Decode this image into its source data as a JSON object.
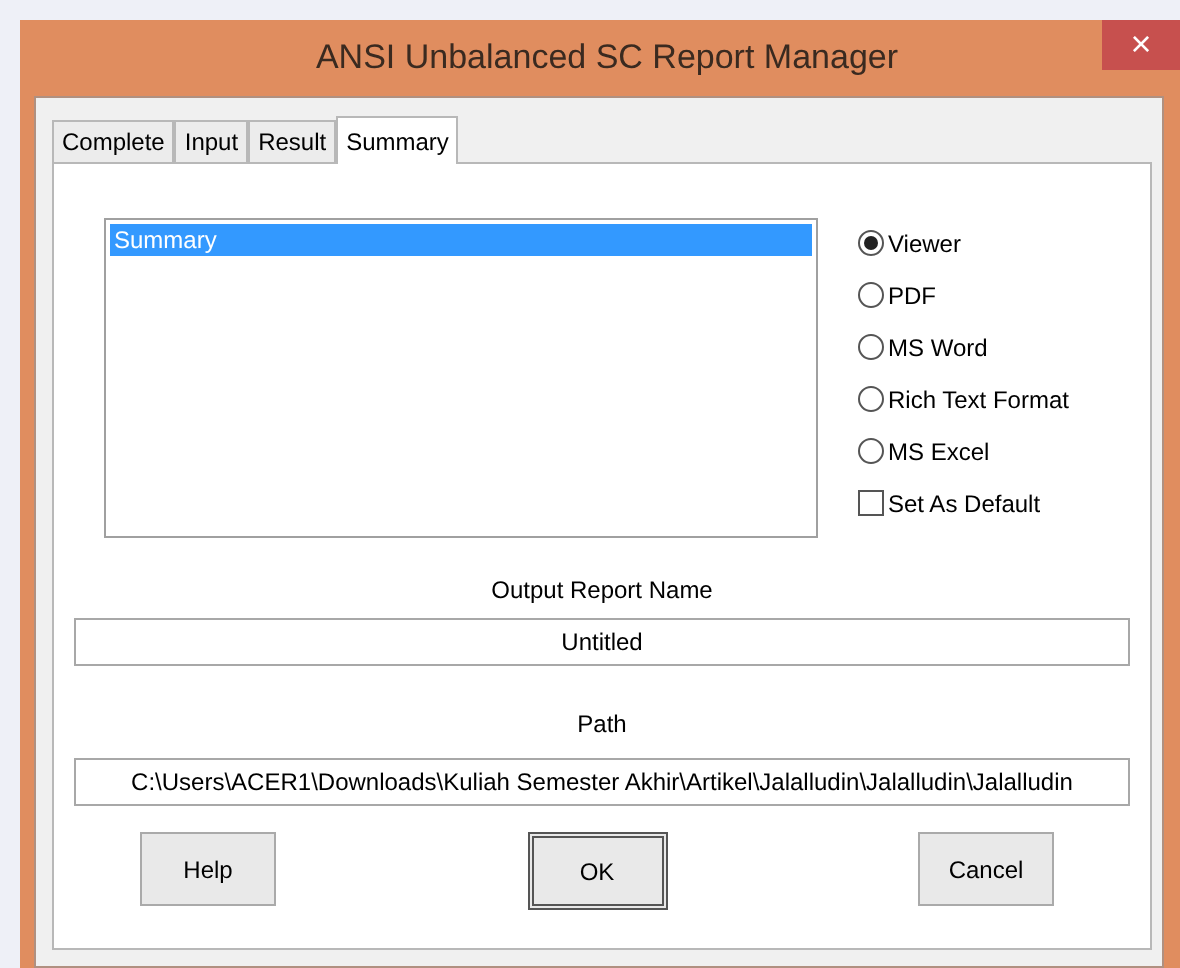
{
  "window": {
    "title": "ANSI Unbalanced SC Report Manager",
    "close": "×"
  },
  "tabs": [
    {
      "label": "Complete",
      "selected": false
    },
    {
      "label": "Input",
      "selected": false
    },
    {
      "label": "Result",
      "selected": false
    },
    {
      "label": "Summary",
      "selected": true
    }
  ],
  "report_list": [
    {
      "label": "Summary",
      "selected": true
    }
  ],
  "formats": [
    {
      "kind": "radio",
      "label": "Viewer",
      "selected": true
    },
    {
      "kind": "radio",
      "label": "PDF",
      "selected": false
    },
    {
      "kind": "radio",
      "label": "MS Word",
      "selected": false
    },
    {
      "kind": "radio",
      "label": "Rich Text Format",
      "selected": false
    },
    {
      "kind": "radio",
      "label": "MS Excel",
      "selected": false
    },
    {
      "kind": "checkbox",
      "label": "Set As Default",
      "checked": false
    }
  ],
  "output_name": {
    "label": "Output Report Name",
    "value": "Untitled"
  },
  "path": {
    "label": "Path",
    "value": "C:\\Users\\ACER1\\Downloads\\Kuliah Semester Akhir\\Artikel\\Jalalludin\\Jalalludin\\Jalalludin"
  },
  "buttons": [
    {
      "label": "Help",
      "default": false
    },
    {
      "label": "OK",
      "default": true
    },
    {
      "label": "Cancel",
      "default": false
    }
  ]
}
